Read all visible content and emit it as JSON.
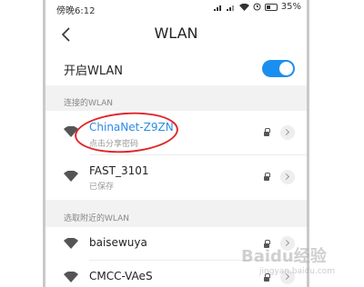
{
  "status_bar": {
    "time": "傍晚6:12",
    "battery": "35%"
  },
  "header": {
    "title": "WLAN",
    "back_icon": "chevron-left-icon"
  },
  "toggle": {
    "label": "开启WLAN",
    "enabled": true
  },
  "sections": {
    "connected_header": "连接的WLAN",
    "nearby_header": "选取附近的WLAN"
  },
  "networks": [
    {
      "name": "ChinaNet-Z9ZN",
      "subtitle": "点击分享密码",
      "locked": true,
      "connected": true
    },
    {
      "name": "FAST_3101",
      "subtitle": "已保存",
      "locked": true,
      "connected": false
    },
    {
      "name": "baisewuya",
      "subtitle": "",
      "locked": true,
      "connected": false
    },
    {
      "name": "CMCC-VAeS",
      "subtitle": "",
      "locked": true,
      "connected": false
    }
  ],
  "watermark": {
    "text": "Baidu经验",
    "subtext": "jingyan.baidu.com"
  },
  "colors": {
    "accent": "#1b8ff0",
    "connected_text": "#2a8ce8",
    "annotation_circle": "#e0262b"
  }
}
